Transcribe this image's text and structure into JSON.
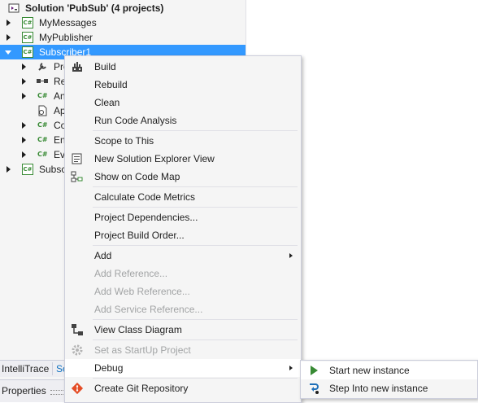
{
  "solution_explorer": {
    "solution_title": "Solution 'PubSub' (4 projects)",
    "projects": [
      {
        "label": "MyMessages"
      },
      {
        "label": "MyPublisher"
      },
      {
        "label": "Subscriber1"
      },
      {
        "label": "Subsc"
      }
    ],
    "children": [
      {
        "label": "Pro"
      },
      {
        "label": "Re"
      },
      {
        "label": "An"
      },
      {
        "label": "Ap"
      },
      {
        "label": "Co"
      },
      {
        "label": "En"
      },
      {
        "label": "Ev"
      }
    ],
    "bottom_tabs": [
      "IntelliTrace",
      "So"
    ],
    "properties_label": "Properties"
  },
  "context_menu": {
    "items": [
      {
        "label": "Build",
        "icon": "build-icon"
      },
      {
        "label": "Rebuild"
      },
      {
        "label": "Clean"
      },
      {
        "label": "Run Code Analysis"
      },
      {
        "label": "Scope to This"
      },
      {
        "label": "New Solution Explorer View",
        "icon": "new-view-icon"
      },
      {
        "label": "Show on Code Map",
        "icon": "code-map-icon"
      },
      {
        "label": "Calculate Code Metrics"
      },
      {
        "label": "Project Dependencies..."
      },
      {
        "label": "Project Build Order..."
      },
      {
        "label": "Add",
        "submenu": true
      },
      {
        "label": "Add Reference...",
        "disabled": true
      },
      {
        "label": "Add Web Reference...",
        "disabled": true
      },
      {
        "label": "Add Service Reference...",
        "disabled": true
      },
      {
        "label": "View Class Diagram",
        "icon": "class-diagram-icon"
      },
      {
        "label": "Set as StartUp Project",
        "icon": "gear-icon",
        "disabled": true
      },
      {
        "label": "Debug",
        "submenu": true,
        "highlighted": true
      },
      {
        "label": "Create Git Repository",
        "icon": "git-icon"
      }
    ]
  },
  "debug_submenu": {
    "items": [
      {
        "label": "Start new instance",
        "icon": "play-icon",
        "highlighted": true
      },
      {
        "label": "Step Into new instance",
        "icon": "step-into-icon"
      }
    ]
  },
  "colors": {
    "selection": "#3399ff",
    "menu_background": "#f5f5f5",
    "disabled_text": "#a2a4a5",
    "csharp_green": "#388a34",
    "play_green": "#388a34",
    "git_red": "#e44d26"
  }
}
